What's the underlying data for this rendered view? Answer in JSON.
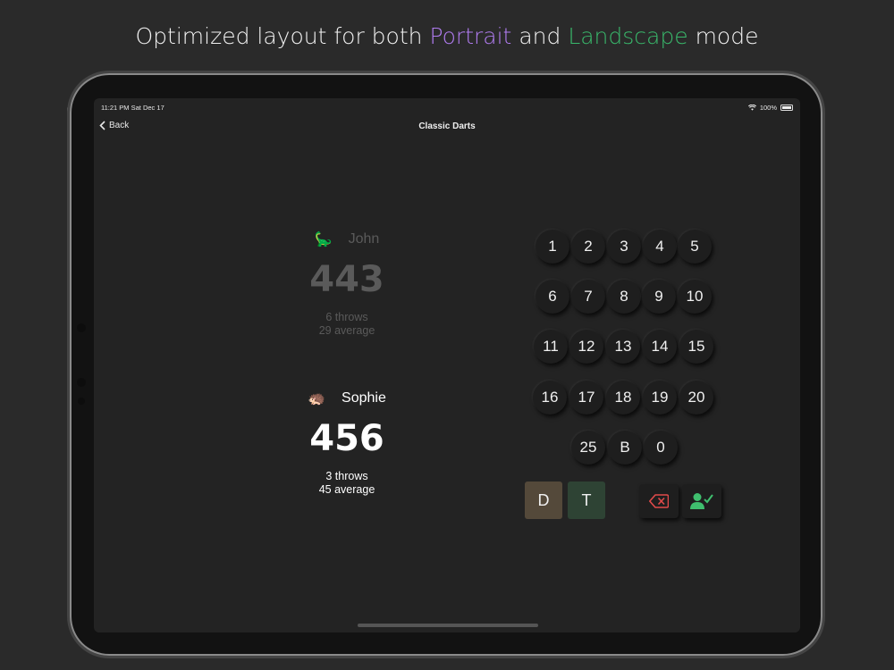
{
  "headline": {
    "prefix": "Optimized layout for both ",
    "portrait": "Portrait",
    "middle": " and ",
    "landscape": "Landscape",
    "suffix": " mode"
  },
  "colors": {
    "portrait": "#b07cf0",
    "landscape": "#39b86b",
    "double": "#54493a",
    "triple": "#2e4334"
  },
  "status_bar": {
    "time": "11:21 PM  Sat Dec 17",
    "battery": "100%",
    "icons": [
      "wifi-icon",
      "battery-icon"
    ]
  },
  "nav": {
    "back_label": "Back",
    "title": "Classic Darts"
  },
  "players": [
    {
      "avatar": "🦕",
      "name": "John",
      "score": "443",
      "throws": "6 throws",
      "average": "29 average",
      "active": false
    },
    {
      "avatar": "🦔",
      "name": "Sophie",
      "score": "456",
      "throws": "3 throws",
      "average": "45 average",
      "active": true
    }
  ],
  "keypad": {
    "row1": [
      "1",
      "2",
      "3",
      "4",
      "5"
    ],
    "row2": [
      "6",
      "7",
      "8",
      "9",
      "10"
    ],
    "row3": [
      "11",
      "12",
      "13",
      "14",
      "15"
    ],
    "row4": [
      "16",
      "17",
      "18",
      "19",
      "20"
    ],
    "row5": [
      "25",
      "B",
      "0"
    ]
  },
  "modifiers": {
    "double": "D",
    "triple": "T"
  },
  "actions": {
    "delete_icon": "backspace-icon",
    "confirm_icon": "user-check-icon"
  }
}
